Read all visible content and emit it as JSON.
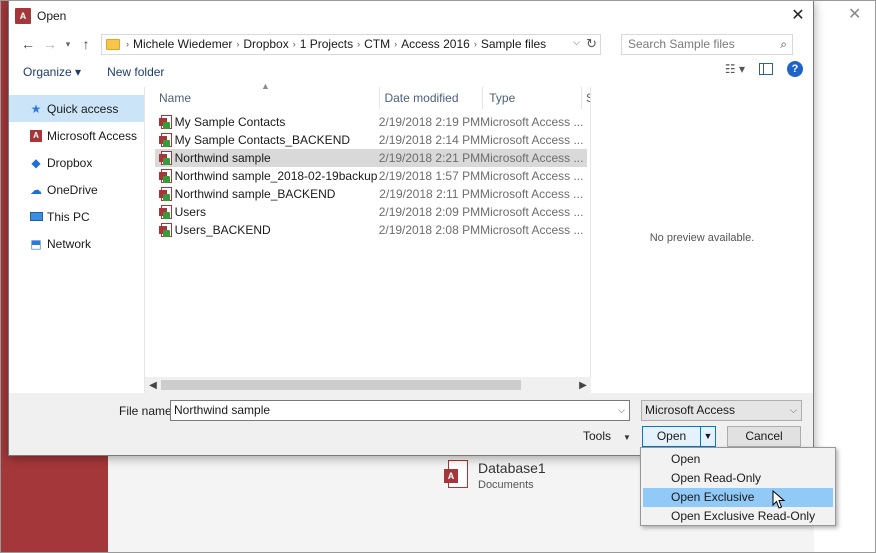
{
  "background": {
    "recent_item": {
      "name": "Database1",
      "location": "Documents",
      "icon": "access-file-icon"
    },
    "close_glyph": "✕"
  },
  "dialog": {
    "title": "Open",
    "app_icon": "A",
    "close_glyph": "✕"
  },
  "addressbar": {
    "crumbs": [
      "Michele Wiedemer",
      "Dropbox",
      "1 Projects",
      "CTM",
      "Access 2016",
      "Sample files"
    ],
    "search_placeholder": "Search Sample files"
  },
  "toolbar": {
    "organize_label": "Organize ▾",
    "new_folder_label": "New folder"
  },
  "navpane": {
    "items": [
      {
        "label": "Quick access",
        "icon": "star-icon",
        "selected": true
      },
      {
        "label": "Microsoft Access",
        "icon": "access-icon",
        "selected": false
      },
      {
        "label": "Dropbox",
        "icon": "dropbox-icon",
        "selected": false
      },
      {
        "label": "OneDrive",
        "icon": "onedrive-icon",
        "selected": false
      },
      {
        "label": "This PC",
        "icon": "pc-icon",
        "selected": false
      },
      {
        "label": "Network",
        "icon": "network-icon",
        "selected": false
      }
    ]
  },
  "filelist": {
    "columns": [
      "Name",
      "Date modified",
      "Type",
      "S"
    ],
    "rows": [
      {
        "name": "My Sample Contacts",
        "date": "2/19/2018 2:19 PM",
        "type": "Microsoft Access ...",
        "selected": false
      },
      {
        "name": "My Sample Contacts_BACKEND",
        "date": "2/19/2018 2:14 PM",
        "type": "Microsoft Access ...",
        "selected": false
      },
      {
        "name": "Northwind sample",
        "date": "2/19/2018 2:21 PM",
        "type": "Microsoft Access ...",
        "selected": true
      },
      {
        "name": "Northwind sample_2018-02-19backup",
        "date": "2/19/2018 1:57 PM",
        "type": "Microsoft Access ...",
        "selected": false
      },
      {
        "name": "Northwind sample_BACKEND",
        "date": "2/19/2018 2:11 PM",
        "type": "Microsoft Access ...",
        "selected": false
      },
      {
        "name": "Users",
        "date": "2/19/2018 2:09 PM",
        "type": "Microsoft Access ...",
        "selected": false
      },
      {
        "name": "Users_BACKEND",
        "date": "2/19/2018 2:08 PM",
        "type": "Microsoft Access ...",
        "selected": false
      }
    ]
  },
  "preview": {
    "text": "No preview available."
  },
  "bottom": {
    "file_name_label": "File name:",
    "file_name_value": "Northwind sample",
    "file_type_value": "Microsoft Access",
    "tools_label": "Tools",
    "open_label": "Open",
    "cancel_label": "Cancel"
  },
  "open_menu": {
    "items": [
      "Open",
      "Open Read-Only",
      "Open Exclusive",
      "Open Exclusive Read-Only"
    ],
    "highlighted": "Open Exclusive"
  },
  "colors": {
    "access_red": "#a4373a",
    "selection_blue": "#cce4f7",
    "menu_highlight": "#91c9f7",
    "button_border": "#0078d7"
  }
}
